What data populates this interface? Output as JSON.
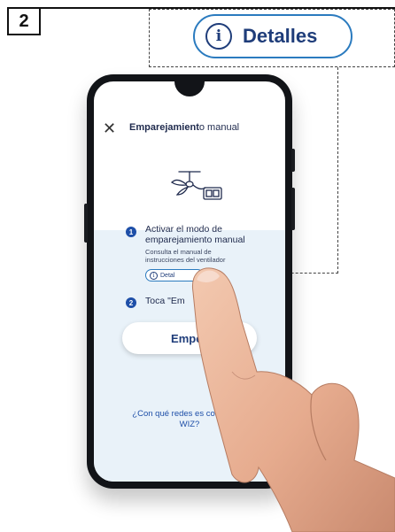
{
  "step_number": "2",
  "callout": {
    "label": "Detalles",
    "icon": "info-icon"
  },
  "app": {
    "header": {
      "title_bold": "Emparejamient",
      "title_rest": "o manual",
      "close_icon": "close-icon"
    },
    "illustration_icon": "ceiling-fan-with-remote-icon",
    "steps": [
      {
        "number": "1",
        "title": "Activar el modo de emparejamiento manual",
        "description": "Consulta el manual de instrucciones del ventilador",
        "details_button": "Detal"
      },
      {
        "number": "2",
        "text": "Toca \"Em"
      }
    ],
    "start_button": "Empez",
    "compat_link": "¿Con qué redes es compatible WIZ?"
  },
  "colors": {
    "accent": "#1e4fa8",
    "pill_border": "#2b7bbf",
    "screen_background": "#e9f2f9"
  }
}
